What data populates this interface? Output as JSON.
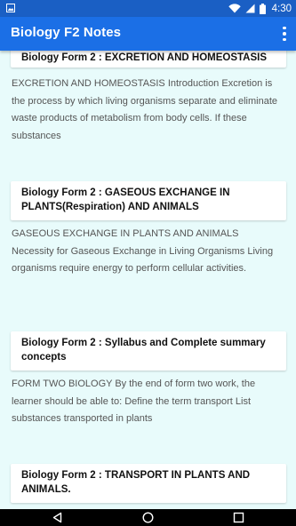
{
  "status_bar": {
    "time": "4:30",
    "icons": [
      "gallery-icon",
      "wifi-icon",
      "signal-icon",
      "battery-icon"
    ]
  },
  "app_bar": {
    "title": "Biology F2 Notes",
    "menu_icon": "more-vert-icon"
  },
  "posts": [
    {
      "title": "Biology Form 2 : EXCRETION AND HOMEOSTASIS",
      "excerpt": "EXCRETION AND HOMEOSTASIS Introduction Excretion is the process by which living organisms separate and eliminate waste products of metabolism from body cells. If these substances"
    },
    {
      "title": "Biology Form 2 : GASEOUS EXCHANGE IN PLANTS(Respiration) AND ANIMALS",
      "excerpt": "GASEOUS EXCHANGE IN PLANTS AND ANIMALS Necessity for Gaseous Exchange in Living Organisms Living organisms require energy to perform cellular activities."
    },
    {
      "title": "Biology Form 2 : Syllabus and Complete summary concepts",
      "excerpt": "FORM TWO BIOLOGY By the end of form two work, the learner should be able to: Define the term transport List substances transported in plants"
    },
    {
      "title": "Biology Form 2 : TRANSPORT IN PLANTS AND ANIMALS.",
      "excerpt": ""
    }
  ],
  "nav_bar": {
    "buttons": [
      "back-icon",
      "home-icon",
      "recents-icon"
    ]
  },
  "colors": {
    "status_bar": "#1a5fc4",
    "app_bar": "#1b6fe6",
    "background": "#e8fbfb",
    "card": "#ffffff"
  }
}
